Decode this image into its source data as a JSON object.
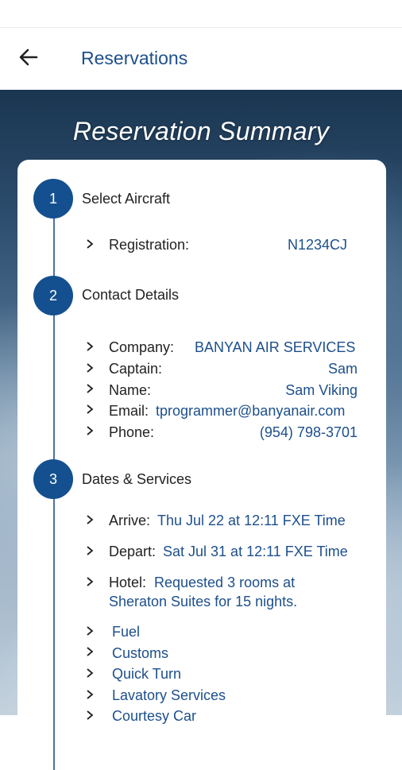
{
  "appbar": {
    "title": "Reservations"
  },
  "hero": {
    "title": "Reservation Summary"
  },
  "steps": [
    {
      "number": "1",
      "title": "Select Aircraft"
    },
    {
      "number": "2",
      "title": "Contact Details"
    },
    {
      "number": "3",
      "title": "Dates & Services"
    }
  ],
  "aircraft": {
    "registration_label": "Registration:",
    "registration_value": "N1234CJ"
  },
  "contact": {
    "company_label": "Company:",
    "company_value": "BANYAN AIR SERVICES",
    "captain_label": "Captain:",
    "captain_value": "Sam",
    "name_label": "Name:",
    "name_value": "Sam Viking",
    "email_label": "Email:",
    "email_value": "tprogrammer@banyanair.com",
    "phone_label": "Phone:",
    "phone_value": "(954) 798-3701"
  },
  "dates": {
    "arrive_label": "Arrive:",
    "arrive_value": "Thu Jul 22 at 12:11 FXE Time",
    "depart_label": "Depart:",
    "depart_value": "Sat Jul 31 at 12:11 FXE Time",
    "hotel_label": "Hotel:",
    "hotel_line1": "Requested 3 rooms at",
    "hotel_line2": "Sheraton Suites for 15 nights."
  },
  "services": [
    "Fuel",
    "Customs",
    "Quick Turn",
    "Lavatory Services",
    "Courtesy Car"
  ],
  "colors": {
    "accent": "#1d4f8c",
    "step_circle": "#14508f"
  },
  "icons": {
    "back": "arrow-left-icon",
    "chevron": "chevron-right-icon"
  }
}
